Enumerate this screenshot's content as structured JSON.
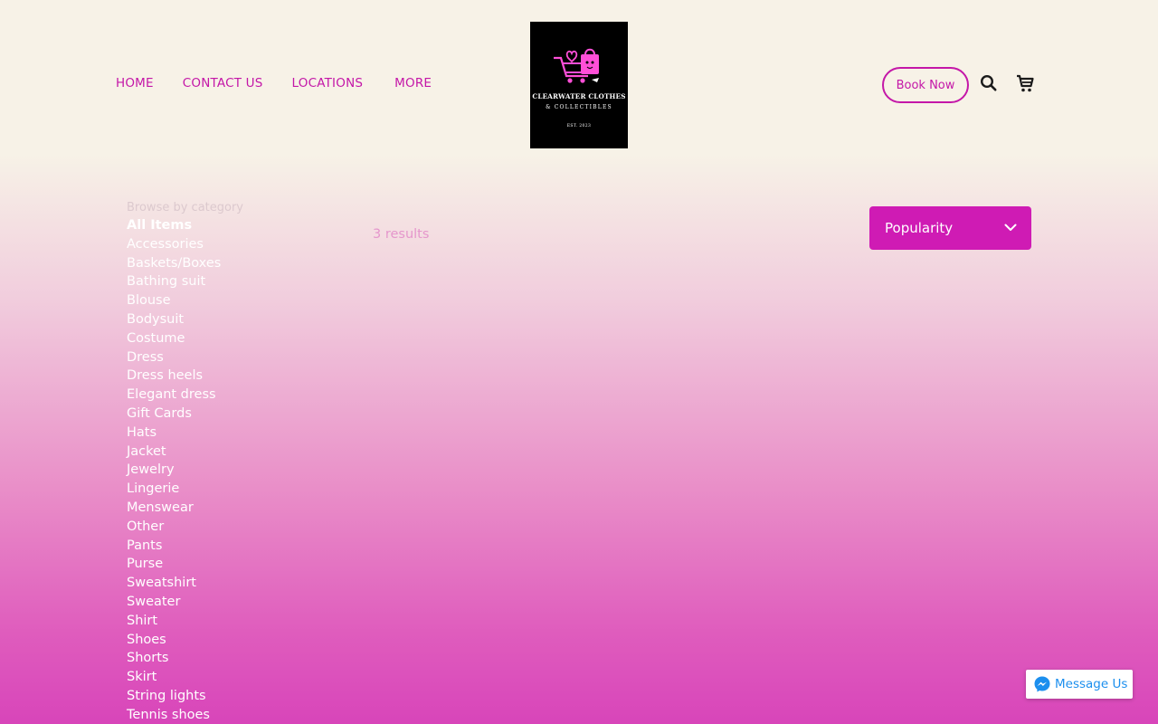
{
  "nav": {
    "items": [
      {
        "label": "HOME"
      },
      {
        "label": "CONTACT US"
      },
      {
        "label": "LOCATIONS"
      },
      {
        "label": "MORE"
      }
    ]
  },
  "logo": {
    "name": "CLEARWATER CLOTHES",
    "subtitle": "& COLLECTIBLES",
    "established": "EST. 2023",
    "icon": "shopping-bag-cart-icon"
  },
  "header": {
    "book_label": "Book Now",
    "search_icon": "search-icon",
    "cart_icon": "cart-icon"
  },
  "sidebar": {
    "heading": "Browse by category",
    "categories": [
      "All Items",
      "Accessories",
      "Baskets/Boxes",
      "Bathing suit",
      "Blouse",
      "Bodysuit",
      "Costume",
      "Dress",
      "Dress heels",
      "Elegant dress",
      "Gift Cards",
      "Hats",
      "Jacket",
      "Jewelry",
      "Lingerie",
      "Menswear",
      "Other",
      "Pants",
      "Purse",
      "Sweatshirt",
      "Sweater",
      "Shirt",
      "Shoes",
      "Shorts",
      "Skirt",
      "String lights",
      "Tennis shoes"
    ],
    "active": "All Items"
  },
  "main": {
    "results_text": "3 results",
    "sort_value": "Popularity"
  },
  "messenger": {
    "label": "Message Us",
    "icon": "messenger-icon"
  },
  "colors": {
    "accent": "#c417a8",
    "sort_bg": "#cf1bb4",
    "header_bg": "#f7f2e7",
    "messenger_blue": "#1c8fee"
  }
}
